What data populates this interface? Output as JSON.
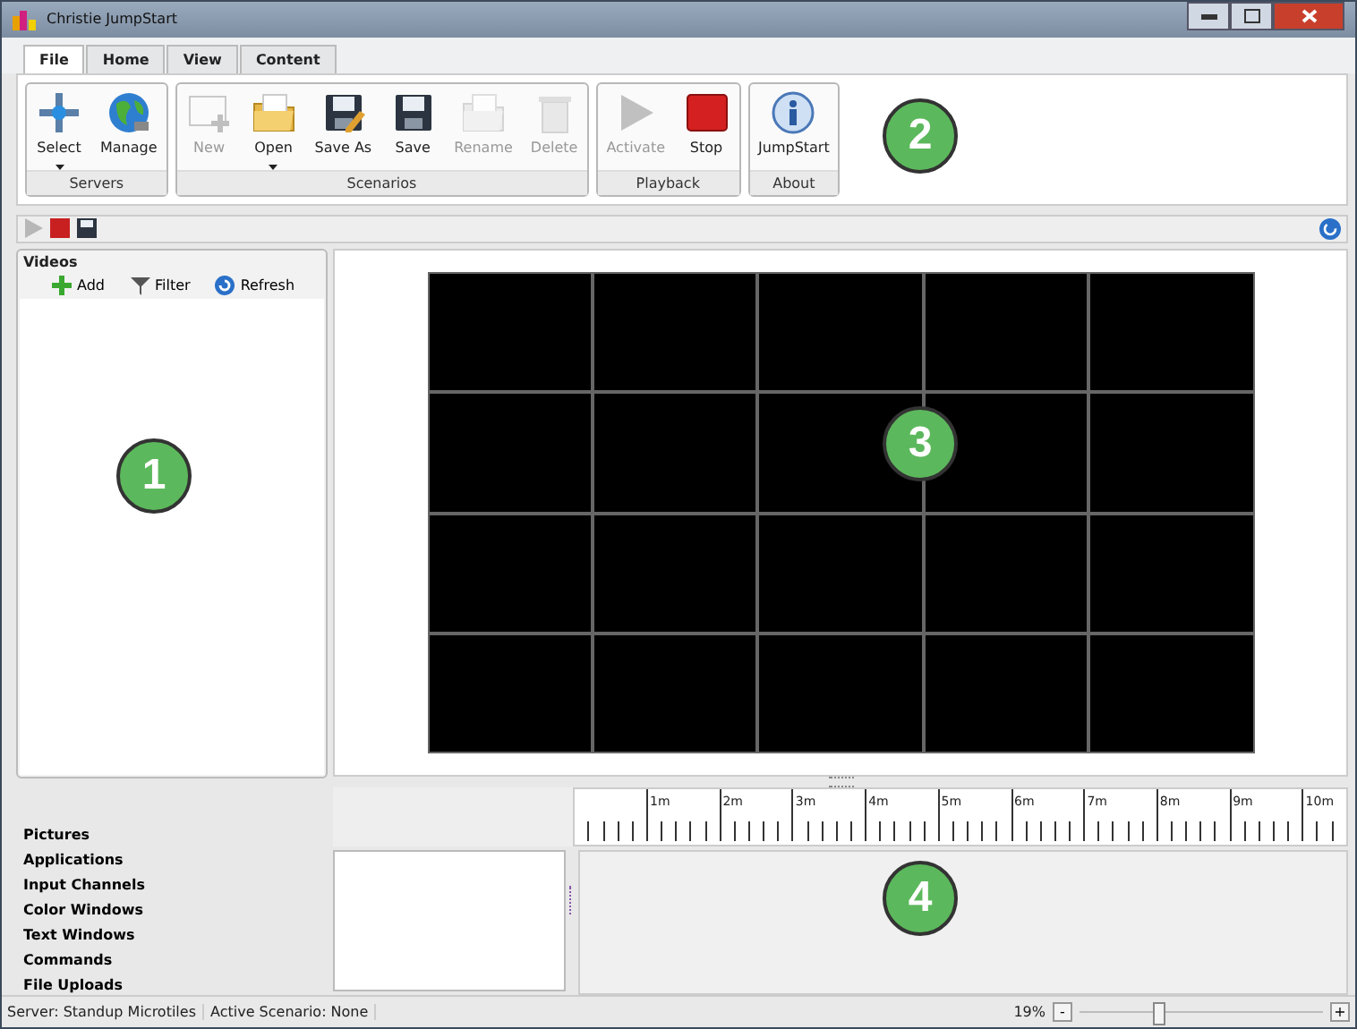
{
  "window": {
    "title": "Christie JumpStart"
  },
  "tabs": [
    {
      "label": "File",
      "selected": true
    },
    {
      "label": "Home",
      "selected": false
    },
    {
      "label": "View",
      "selected": false
    },
    {
      "label": "Content",
      "selected": false
    }
  ],
  "ribbon_groups": [
    {
      "label": "Servers",
      "buttons": [
        {
          "label": "Select",
          "kind": "crosshair",
          "disabled": false,
          "dropdown": true
        },
        {
          "label": "Manage",
          "kind": "globe",
          "disabled": false,
          "dropdown": false
        }
      ]
    },
    {
      "label": "Scenarios",
      "buttons": [
        {
          "label": "New",
          "kind": "new",
          "disabled": true,
          "dropdown": false
        },
        {
          "label": "Open",
          "kind": "folder",
          "disabled": false,
          "dropdown": true
        },
        {
          "label": "Save As",
          "kind": "saveas",
          "disabled": false,
          "dropdown": false
        },
        {
          "label": "Save",
          "kind": "save",
          "disabled": false,
          "dropdown": false
        },
        {
          "label": "Rename",
          "kind": "folder",
          "disabled": true,
          "dropdown": false
        },
        {
          "label": "Delete",
          "kind": "trash",
          "disabled": true,
          "dropdown": false
        }
      ]
    },
    {
      "label": "Playback",
      "buttons": [
        {
          "label": "Activate",
          "kind": "play",
          "disabled": true,
          "dropdown": false
        },
        {
          "label": "Stop",
          "kind": "stop",
          "disabled": false,
          "dropdown": false
        }
      ]
    },
    {
      "label": "About",
      "buttons": [
        {
          "label": "JumpStart",
          "kind": "info",
          "disabled": false,
          "dropdown": false
        }
      ]
    }
  ],
  "toolbar": [
    {
      "kind": "play",
      "disabled": true
    },
    {
      "kind": "stop",
      "disabled": false
    },
    {
      "kind": "save",
      "disabled": false
    }
  ],
  "videos": {
    "title": "Videos",
    "actions": [
      {
        "label": "Add",
        "kind": "plus"
      },
      {
        "label": "Filter",
        "kind": "filter"
      },
      {
        "label": "Refresh",
        "kind": "refresh"
      }
    ]
  },
  "categories": [
    "Pictures",
    "Applications",
    "Input Channels",
    "Color Windows",
    "Text Windows",
    "Commands",
    "File Uploads"
  ],
  "ruler_labels": [
    "1m",
    "2m",
    "3m",
    "4m",
    "5m",
    "6m",
    "7m",
    "8m",
    "9m",
    "10m"
  ],
  "status_bar": {
    "server": "Server: Standup Microtiles",
    "scenario": "Active Scenario: None",
    "zoom": "19%",
    "level": 0.3,
    "minus": "-",
    "plus": "+"
  },
  "callouts": [
    "1",
    "2",
    "3",
    "4"
  ]
}
